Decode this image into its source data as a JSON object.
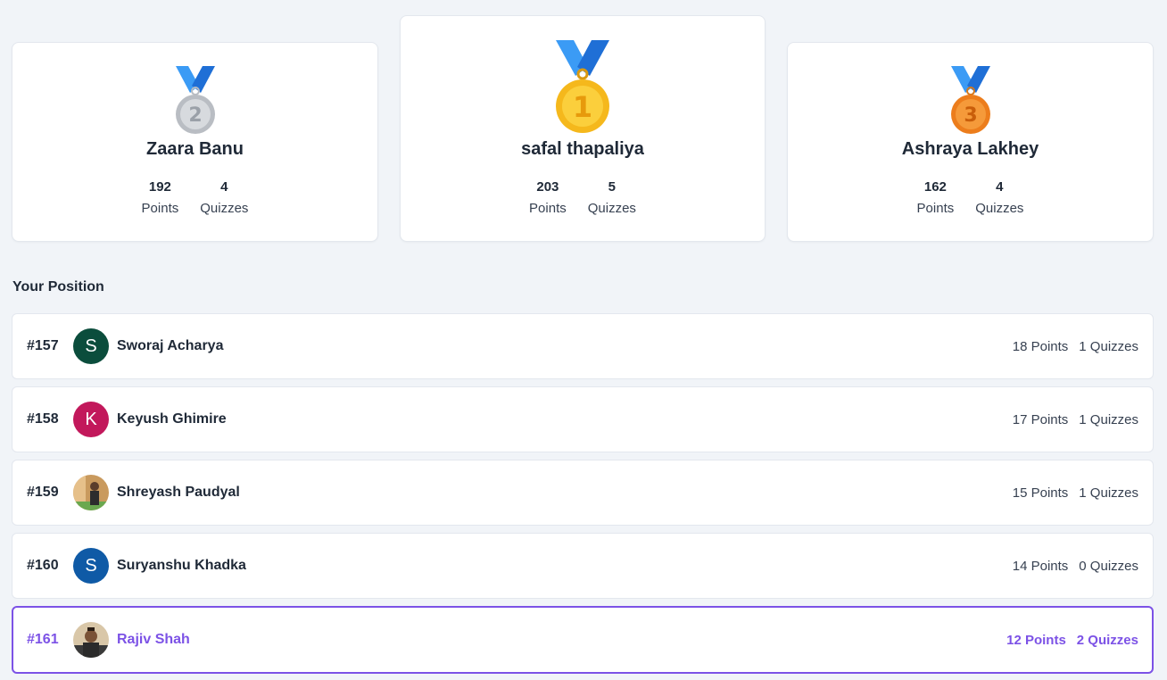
{
  "podium": {
    "first": {
      "rank_icon": "gold-medal-icon",
      "medal_number": "1",
      "name": "safal thapaliya",
      "points": "203",
      "points_label": "Points",
      "quizzes": "5",
      "quizzes_label": "Quizzes"
    },
    "second": {
      "rank_icon": "silver-medal-icon",
      "medal_number": "2",
      "name": "Zaara Banu",
      "points": "192",
      "points_label": "Points",
      "quizzes": "4",
      "quizzes_label": "Quizzes"
    },
    "third": {
      "rank_icon": "bronze-medal-icon",
      "medal_number": "3",
      "name": "Ashraya Lakhey",
      "points": "162",
      "points_label": "Points",
      "quizzes": "4",
      "quizzes_label": "Quizzes"
    }
  },
  "position": {
    "title": "Your Position",
    "rows": [
      {
        "rank": "#157",
        "initial": "S",
        "avatar_color": "#0b4d3c",
        "name": "Sworaj Acharya",
        "points": "18 Points",
        "quizzes": "1 Quizzes"
      },
      {
        "rank": "#158",
        "initial": "K",
        "avatar_color": "#c2185b",
        "name": "Keyush Ghimire",
        "points": "17 Points",
        "quizzes": "1 Quizzes"
      },
      {
        "rank": "#159",
        "initial": "",
        "avatar_color": "#b58a5a",
        "name": "Shreyash Paudyal",
        "points": "15 Points",
        "quizzes": "1 Quizzes"
      },
      {
        "rank": "#160",
        "initial": "S",
        "avatar_color": "#0f5aa6",
        "name": "Suryanshu Khadka",
        "points": "14 Points",
        "quizzes": "0 Quizzes"
      },
      {
        "rank": "#161",
        "initial": "",
        "avatar_color": "#6b5a48",
        "name": "Rajiv Shah",
        "points": "12 Points",
        "quizzes": "2 Quizzes",
        "is_current_user": true
      }
    ]
  },
  "colors": {
    "accent": "#7c52e6",
    "gold": "#f5b81c",
    "silver": "#c9ccd1",
    "bronze": "#f08a24",
    "ribbon": "#2f8ef0"
  }
}
